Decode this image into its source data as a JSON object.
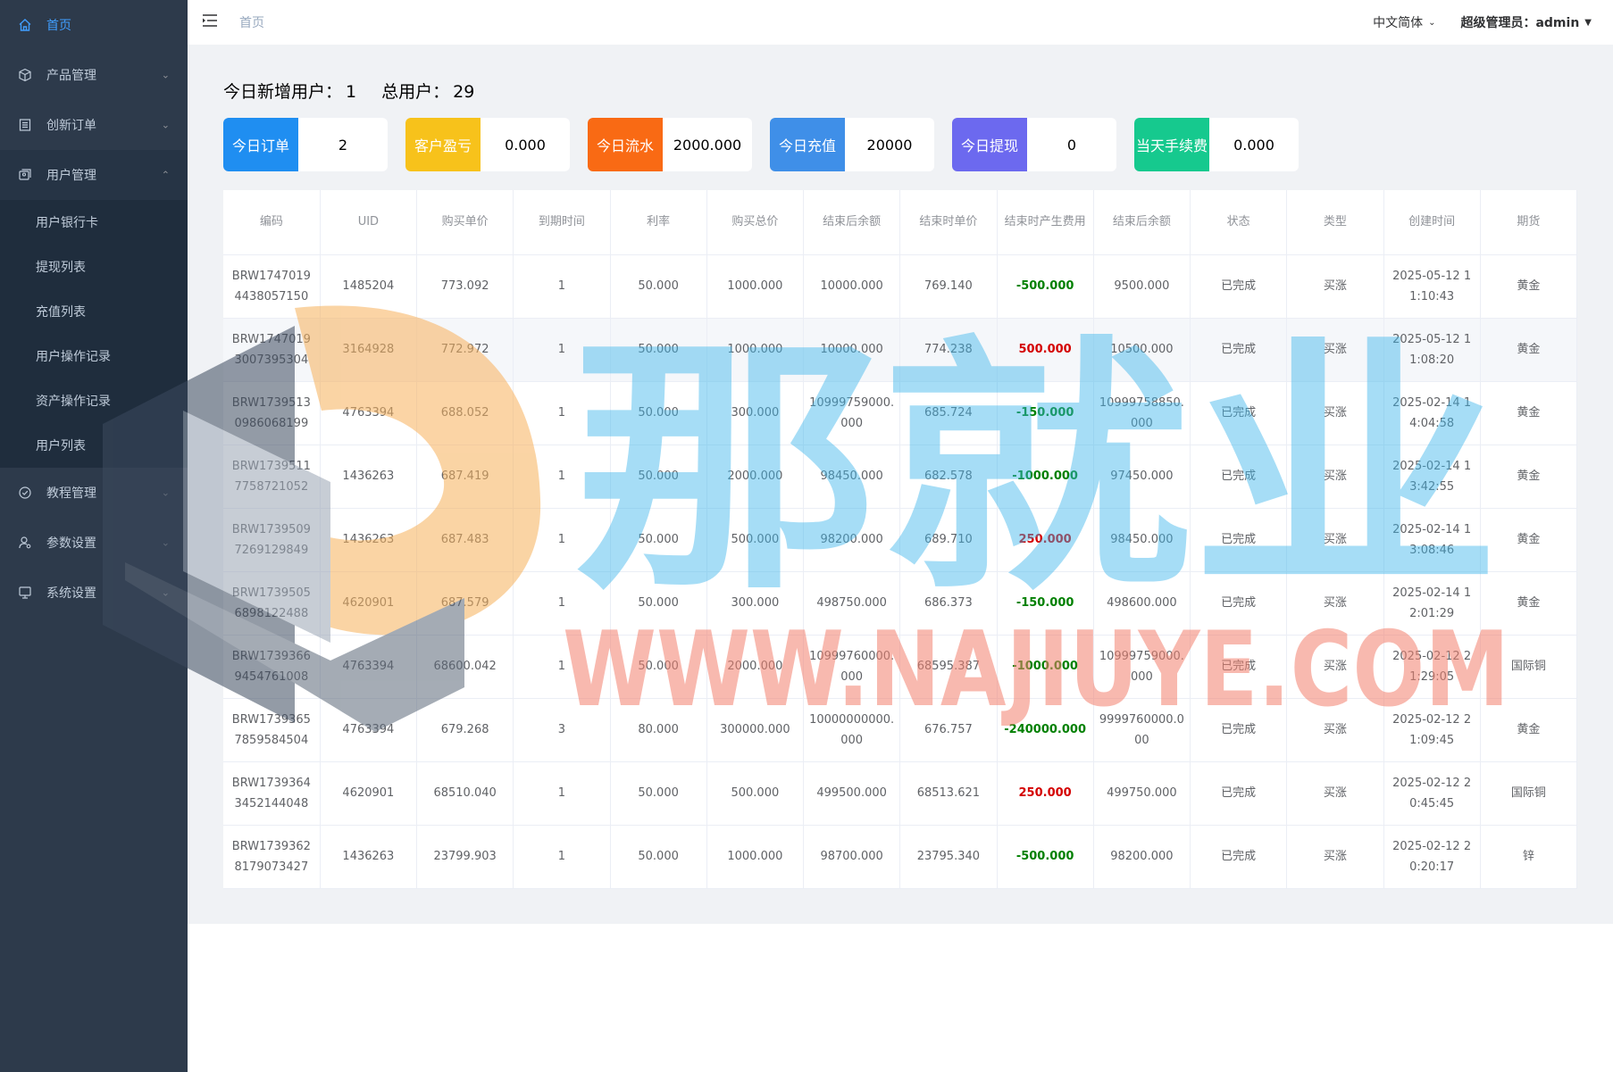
{
  "sidebar": {
    "items": [
      {
        "label": "首页",
        "icon": "home-icon"
      },
      {
        "label": "产品管理",
        "icon": "box-icon"
      },
      {
        "label": "创新订单",
        "icon": "list-icon"
      },
      {
        "label": "用户管理",
        "icon": "user-group-icon"
      },
      {
        "label": "教程管理",
        "icon": "check-circle-icon"
      },
      {
        "label": "参数设置",
        "icon": "user-settings-icon"
      },
      {
        "label": "系统设置",
        "icon": "monitor-icon"
      }
    ],
    "submenu": [
      "用户银行卡",
      "提现列表",
      "充值列表",
      "用户操作记录",
      "资产操作记录",
      "用户列表"
    ]
  },
  "header": {
    "breadcrumb": "首页",
    "language": "中文简体",
    "user": "超级管理员：admin"
  },
  "stats": {
    "new_users_label": "今日新增用户：",
    "new_users": "1",
    "total_users_label": "总用户：",
    "total_users": "29"
  },
  "cards": [
    {
      "label": "今日订单",
      "value": "2",
      "color": "#1f8ef1"
    },
    {
      "label": "客户盈亏",
      "value": "0.000",
      "color": "#f7c21b"
    },
    {
      "label": "今日流水",
      "value": "2000.000",
      "color": "#f96a14"
    },
    {
      "label": "今日充值",
      "value": "20000",
      "color": "#3f8fe8"
    },
    {
      "label": "今日提现",
      "value": "0",
      "color": "#6c69ef"
    },
    {
      "label": "当天手续费",
      "value": "0.000",
      "color": "#16c98e"
    }
  ],
  "table": {
    "columns": [
      "编码",
      "UID",
      "购买单价",
      "到期时间",
      "利率",
      "购买总价",
      "结束后余额",
      "结束时单价",
      "结束时产生费用",
      "结束后余额",
      "状态",
      "类型",
      "创建时间",
      "期货"
    ],
    "rows": [
      [
        "BRW17470194438057150",
        "1485204",
        "773.092",
        "1",
        "50.000",
        "1000.000",
        "10000.000",
        "769.140",
        "-500.000",
        "9500.000",
        "已完成",
        "买涨",
        "2025-05-12 11:10:43",
        "黄金"
      ],
      [
        "BRW17470193007395304",
        "3164928",
        "772.972",
        "1",
        "50.000",
        "1000.000",
        "10000.000",
        "774.238",
        "500.000",
        "10500.000",
        "已完成",
        "买涨",
        "2025-05-12 11:08:20",
        "黄金"
      ],
      [
        "BRW17395130986068199",
        "4763394",
        "688.052",
        "1",
        "50.000",
        "300.000",
        "10999759000.000",
        "685.724",
        "-150.000",
        "10999758850.000",
        "已完成",
        "买涨",
        "2025-02-14 14:04:58",
        "黄金"
      ],
      [
        "BRW17395117758721052",
        "1436263",
        "687.419",
        "1",
        "50.000",
        "2000.000",
        "98450.000",
        "682.578",
        "-1000.000",
        "97450.000",
        "已完成",
        "买涨",
        "2025-02-14 13:42:55",
        "黄金"
      ],
      [
        "BRW17395097269129849",
        "1436263",
        "687.483",
        "1",
        "50.000",
        "500.000",
        "98200.000",
        "689.710",
        "250.000",
        "98450.000",
        "已完成",
        "买涨",
        "2025-02-14 13:08:46",
        "黄金"
      ],
      [
        "BRW17395056898122488",
        "4620901",
        "687.579",
        "1",
        "50.000",
        "300.000",
        "498750.000",
        "686.373",
        "-150.000",
        "498600.000",
        "已完成",
        "买涨",
        "2025-02-14 12:01:29",
        "黄金"
      ],
      [
        "BRW17393669454761008",
        "4763394",
        "68600.042",
        "1",
        "50.000",
        "2000.000",
        "10999760000.000",
        "68595.387",
        "-1000.000",
        "10999759000.000",
        "已完成",
        "买涨",
        "2025-02-12 21:29:05",
        "国际铜"
      ],
      [
        "BRW17393657859584504",
        "4763394",
        "679.268",
        "3",
        "80.000",
        "300000.000",
        "10000000000.000",
        "676.757",
        "-240000.000",
        "9999760000.000",
        "已完成",
        "买涨",
        "2025-02-12 21:09:45",
        "黄金"
      ],
      [
        "BRW17393643452144048",
        "4620901",
        "68510.040",
        "1",
        "50.000",
        "500.000",
        "499500.000",
        "68513.621",
        "250.000",
        "499750.000",
        "已完成",
        "买涨",
        "2025-02-12 20:45:45",
        "国际铜"
      ],
      [
        "BRW17393628179073427",
        "1436263",
        "23799.903",
        "1",
        "50.000",
        "1000.000",
        "98700.000",
        "23795.340",
        "-500.000",
        "98200.000",
        "已完成",
        "买涨",
        "2025-02-12 20:20:17",
        "锌"
      ]
    ]
  },
  "watermark": {
    "text": "WWW.NAJIUYE.COM",
    "chinese": "那就业"
  }
}
